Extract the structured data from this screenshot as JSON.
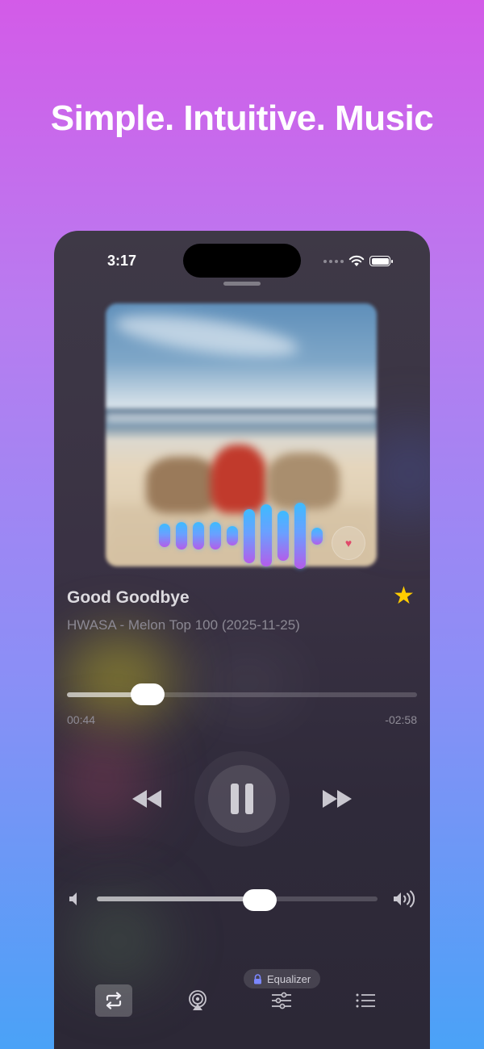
{
  "headline": "Simple. Intuitive. Music",
  "status_bar": {
    "time": "3:17"
  },
  "now_playing": {
    "title": "Good Goodbye",
    "subtitle": "HWASA - Melon Top 100 (2025-11-25)",
    "favorite": true,
    "favorite_icon": "star-icon"
  },
  "visualizer": {
    "levels": [
      0.3,
      0.35,
      0.35,
      0.35,
      0.25,
      0.7,
      0.8,
      0.65,
      0.85,
      0.22
    ]
  },
  "playback": {
    "elapsed": "00:44",
    "remaining": "-02:58",
    "progress": 0.23,
    "state": "playing"
  },
  "volume": {
    "level": 0.58
  },
  "equalizer": {
    "label": "Equalizer",
    "locked": true
  },
  "tabs": [
    {
      "name": "repeat",
      "icon": "repeat-icon",
      "active": true
    },
    {
      "name": "airplay",
      "icon": "airplay-icon",
      "active": false
    },
    {
      "name": "equalizer",
      "icon": "sliders-icon",
      "active": false
    },
    {
      "name": "playlist",
      "icon": "list-icon",
      "active": false
    }
  ],
  "colors": {
    "background_top": "#d35be8",
    "background_bottom": "#4aa2f7",
    "favorite_star": "#ffcc00",
    "visualizer_top": "#3dbbff",
    "visualizer_bottom": "#b35dea"
  }
}
